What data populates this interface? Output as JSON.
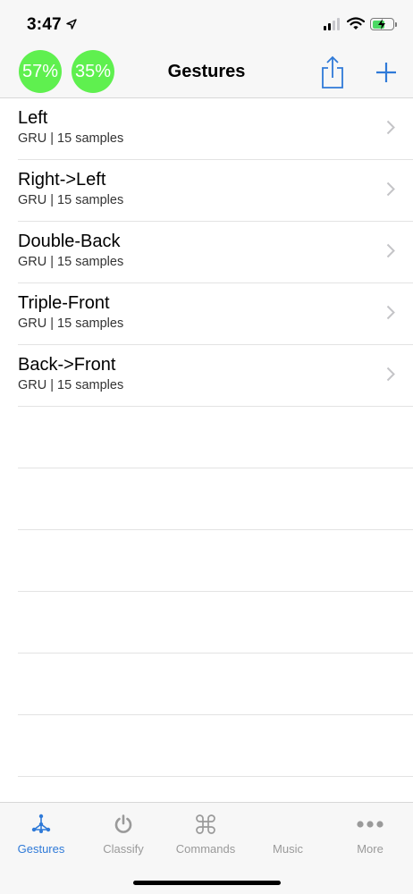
{
  "status_bar": {
    "time": "3:47",
    "icons": [
      "location-arrow-icon",
      "cellular-signal-icon",
      "wifi-icon",
      "battery-charging-icon"
    ]
  },
  "nav": {
    "title": "Gestures",
    "badges": [
      "57%",
      "35%"
    ],
    "badge_color": "#5ff04f",
    "accent": "#2f7ad8"
  },
  "gestures": [
    {
      "name": "Left",
      "subtitle": "GRU | 15 samples"
    },
    {
      "name": "Right->Left",
      "subtitle": "GRU | 15 samples"
    },
    {
      "name": "Double-Back",
      "subtitle": "GRU | 15 samples"
    },
    {
      "name": "Triple-Front",
      "subtitle": "GRU | 15 samples"
    },
    {
      "name": "Back->Front",
      "subtitle": "GRU | 15 samples"
    }
  ],
  "tabs": [
    {
      "label": "Gestures",
      "icon": "gesture-network-icon",
      "active": true
    },
    {
      "label": "Classify",
      "icon": "power-icon",
      "active": false
    },
    {
      "label": "Commands",
      "icon": "command-icon",
      "active": false
    },
    {
      "label": "Music",
      "icon": "music-icon",
      "active": false
    },
    {
      "label": "More",
      "icon": "more-dots-icon",
      "active": false
    }
  ]
}
